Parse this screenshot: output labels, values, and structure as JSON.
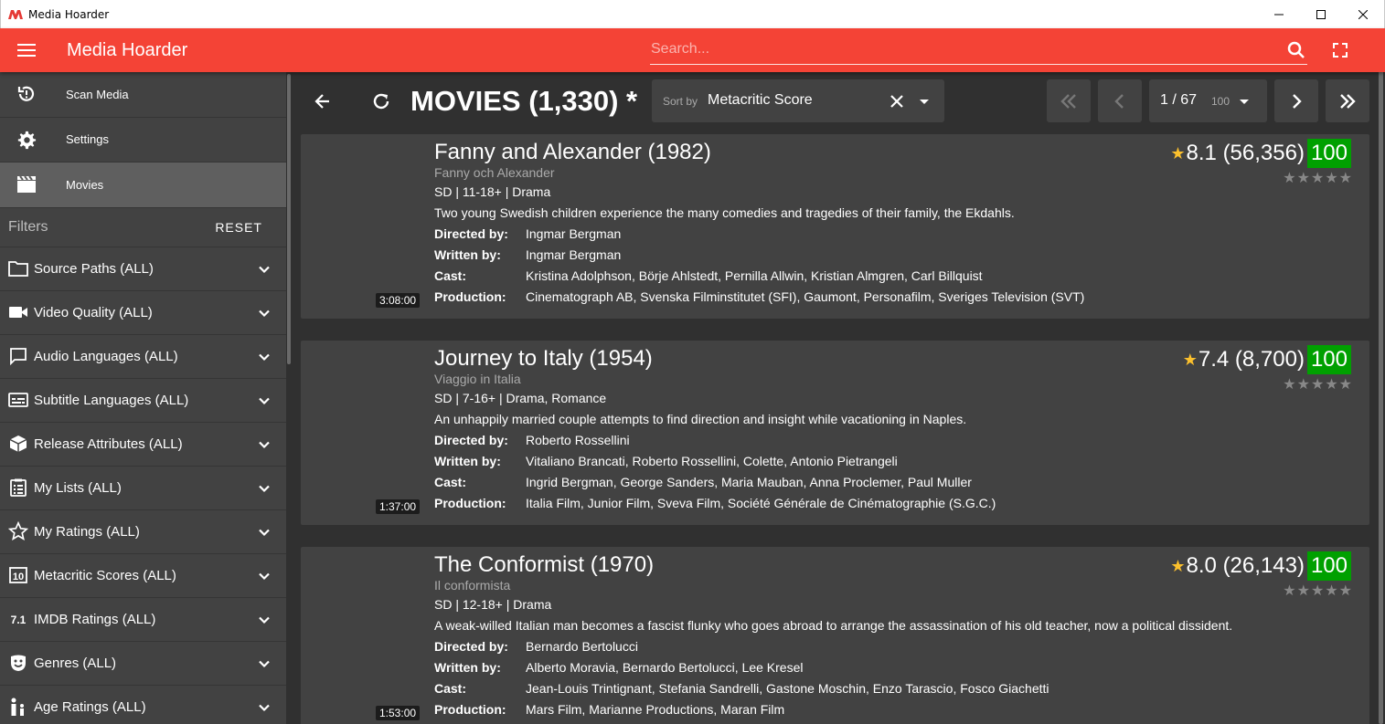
{
  "window": {
    "title": "Media Hoarder"
  },
  "appbar": {
    "title": "Media Hoarder",
    "search_placeholder": "Search..."
  },
  "nav": [
    {
      "label": "Scan Media",
      "icon": "scan-icon"
    },
    {
      "label": "Settings",
      "icon": "gear-icon"
    },
    {
      "label": "Movies",
      "icon": "clapperboard-icon"
    }
  ],
  "filters": {
    "title": "Filters",
    "reset_label": "RESET",
    "items": [
      {
        "label": "Source Paths (ALL)",
        "icon": "folder-icon"
      },
      {
        "label": "Video Quality (ALL)",
        "icon": "video-camera-icon"
      },
      {
        "label": "Audio Languages (ALL)",
        "icon": "speech-bubble-icon"
      },
      {
        "label": "Subtitle Languages (ALL)",
        "icon": "subtitles-icon"
      },
      {
        "label": "Release Attributes (ALL)",
        "icon": "cube-icon"
      },
      {
        "label": "My Lists (ALL)",
        "icon": "clipboard-list-icon"
      },
      {
        "label": "My Ratings (ALL)",
        "icon": "star-outline-icon"
      },
      {
        "label": "Metacritic Scores (ALL)",
        "icon": "metacritic-icon"
      },
      {
        "label": "IMDB Ratings (ALL)",
        "icon": "imdb-rating-icon"
      },
      {
        "label": "Genres (ALL)",
        "icon": "theater-masks-icon"
      },
      {
        "label": "Age Ratings (ALL)",
        "icon": "family-icon"
      }
    ]
  },
  "main": {
    "title": "MOVIES (1,330) *",
    "sort": {
      "label": "Sort by",
      "value": "Metacritic Score"
    },
    "pagination": {
      "current": "1 / 67",
      "page_size": "100"
    }
  },
  "movies": [
    {
      "title": "Fanny and Alexander (1982)",
      "original_title": "Fanny och Alexander",
      "meta": "SD | 11-18+ | Drama",
      "plot": "Two young Swedish children experience the many comedies and tragedies of their family, the Ekdahls.",
      "directed_by": "Ingmar Bergman",
      "written_by": "Ingmar Bergman",
      "cast": "Kristina Adolphson, Börje Ahlstedt, Pernilla Allwin, Kristian Almgren, Carl Billquist",
      "production": "Cinematograph AB, Svenska Filminstitutet (SFI), Gaumont, Personafilm, Sveriges Television (SVT)",
      "runtime": "3:08:00",
      "imdb": "8.1 (56,356)",
      "metacritic": "100"
    },
    {
      "title": "Journey to Italy (1954)",
      "original_title": "Viaggio in Italia",
      "meta": "SD | 7-16+ | Drama, Romance",
      "plot": "An unhappily married couple attempts to find direction and insight while vacationing in Naples.",
      "directed_by": "Roberto Rossellini",
      "written_by": "Vitaliano Brancati, Roberto Rossellini, Colette, Antonio Pietrangeli",
      "cast": "Ingrid Bergman, George Sanders, Maria Mauban, Anna Proclemer, Paul Muller",
      "production": "Italia Film, Junior Film, Sveva Film, Société Générale de Cinématographie (S.G.C.)",
      "runtime": "1:37:00",
      "imdb": "7.4 (8,700)",
      "metacritic": "100"
    },
    {
      "title": "The Conformist (1970)",
      "original_title": "Il conformista",
      "meta": "SD | 12-18+ | Drama",
      "plot": "A weak-willed Italian man becomes a fascist flunky who goes abroad to arrange the assassination of his old teacher, now a political dissident.",
      "directed_by": "Bernardo Bertolucci",
      "written_by": "Alberto Moravia, Bernardo Bertolucci, Lee Kresel",
      "cast": "Jean-Louis Trintignant, Stefania Sandrelli, Gastone Moschin, Enzo Tarascio, Fosco Giachetti",
      "production": "Mars Film, Marianne Productions, Maran Film",
      "runtime": "1:53:00",
      "imdb": "8.0 (26,143)",
      "metacritic": "100"
    }
  ],
  "labels": {
    "directed_by": "Directed by:",
    "written_by": "Written by:",
    "cast": "Cast:",
    "production": "Production:",
    "star": "★",
    "user_stars": "★★★★★"
  },
  "colors": {
    "accent": "#f44336",
    "metacritic_good": "#00a000",
    "imdb_star": "#fbc02d"
  }
}
